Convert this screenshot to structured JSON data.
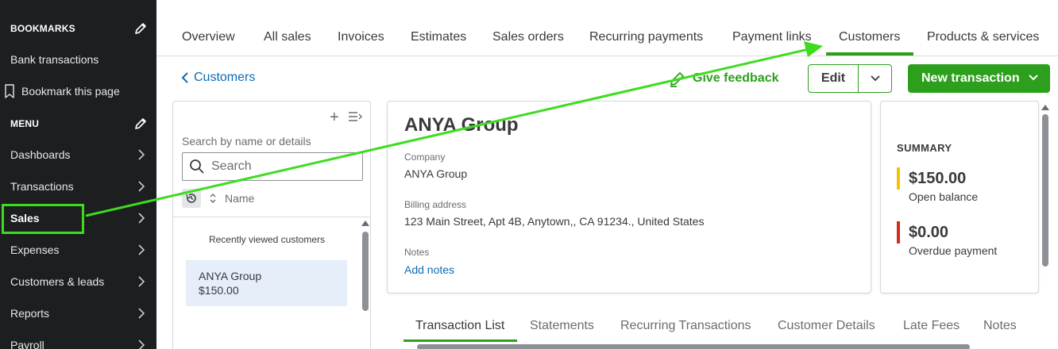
{
  "sidebar": {
    "bookmarks_header": "BOOKMARKS",
    "bank_transactions": "Bank transactions",
    "bookmark_page": "Bookmark this page",
    "menu_header": "MENU",
    "items": [
      {
        "label": "Dashboards"
      },
      {
        "label": "Transactions"
      },
      {
        "label": "Sales"
      },
      {
        "label": "Expenses"
      },
      {
        "label": "Customers & leads"
      },
      {
        "label": "Reports"
      },
      {
        "label": "Payroll"
      }
    ]
  },
  "top_tabs": [
    {
      "label": "Overview"
    },
    {
      "label": "All sales"
    },
    {
      "label": "Invoices"
    },
    {
      "label": "Estimates"
    },
    {
      "label": "Sales orders"
    },
    {
      "label": "Recurring payments"
    },
    {
      "label": "Payment links"
    },
    {
      "label": "Customers"
    },
    {
      "label": "Products & services"
    }
  ],
  "header": {
    "back_label": "Customers",
    "feedback_label": "Give feedback",
    "edit_label": "Edit",
    "new_transaction_label": "New transaction"
  },
  "list_panel": {
    "search_label": "Search by name or details",
    "search_placeholder": "Search",
    "sort_label": "Name",
    "recent_label": "Recently viewed customers",
    "rows": [
      {
        "name": "ANYA Group",
        "amount": "$150.00"
      }
    ]
  },
  "customer": {
    "name": "ANYA Group",
    "company_label": "Company",
    "company": "ANYA Group",
    "billing_label": "Billing address",
    "billing": "123 Main Street, Apt 4B, Anytown,, CA 91234., United States",
    "notes_label": "Notes",
    "add_notes": "Add notes"
  },
  "summary": {
    "title": "SUMMARY",
    "open_balance": "$150.00",
    "open_balance_label": "Open balance",
    "overdue": "$0.00",
    "overdue_label": "Overdue payment",
    "open_color": "#f5c400",
    "overdue_color": "#d52b1e"
  },
  "bottom_tabs": [
    {
      "label": "Transaction List"
    },
    {
      "label": "Statements"
    },
    {
      "label": "Recurring Transactions"
    },
    {
      "label": "Customer Details"
    },
    {
      "label": "Late Fees"
    },
    {
      "label": "Notes"
    }
  ],
  "colors": {
    "brand_green": "#2ca01c",
    "annotation_green": "#3ddc1f",
    "link_blue": "#0d6bb3",
    "sidebar_bg": "#1d1e20"
  }
}
